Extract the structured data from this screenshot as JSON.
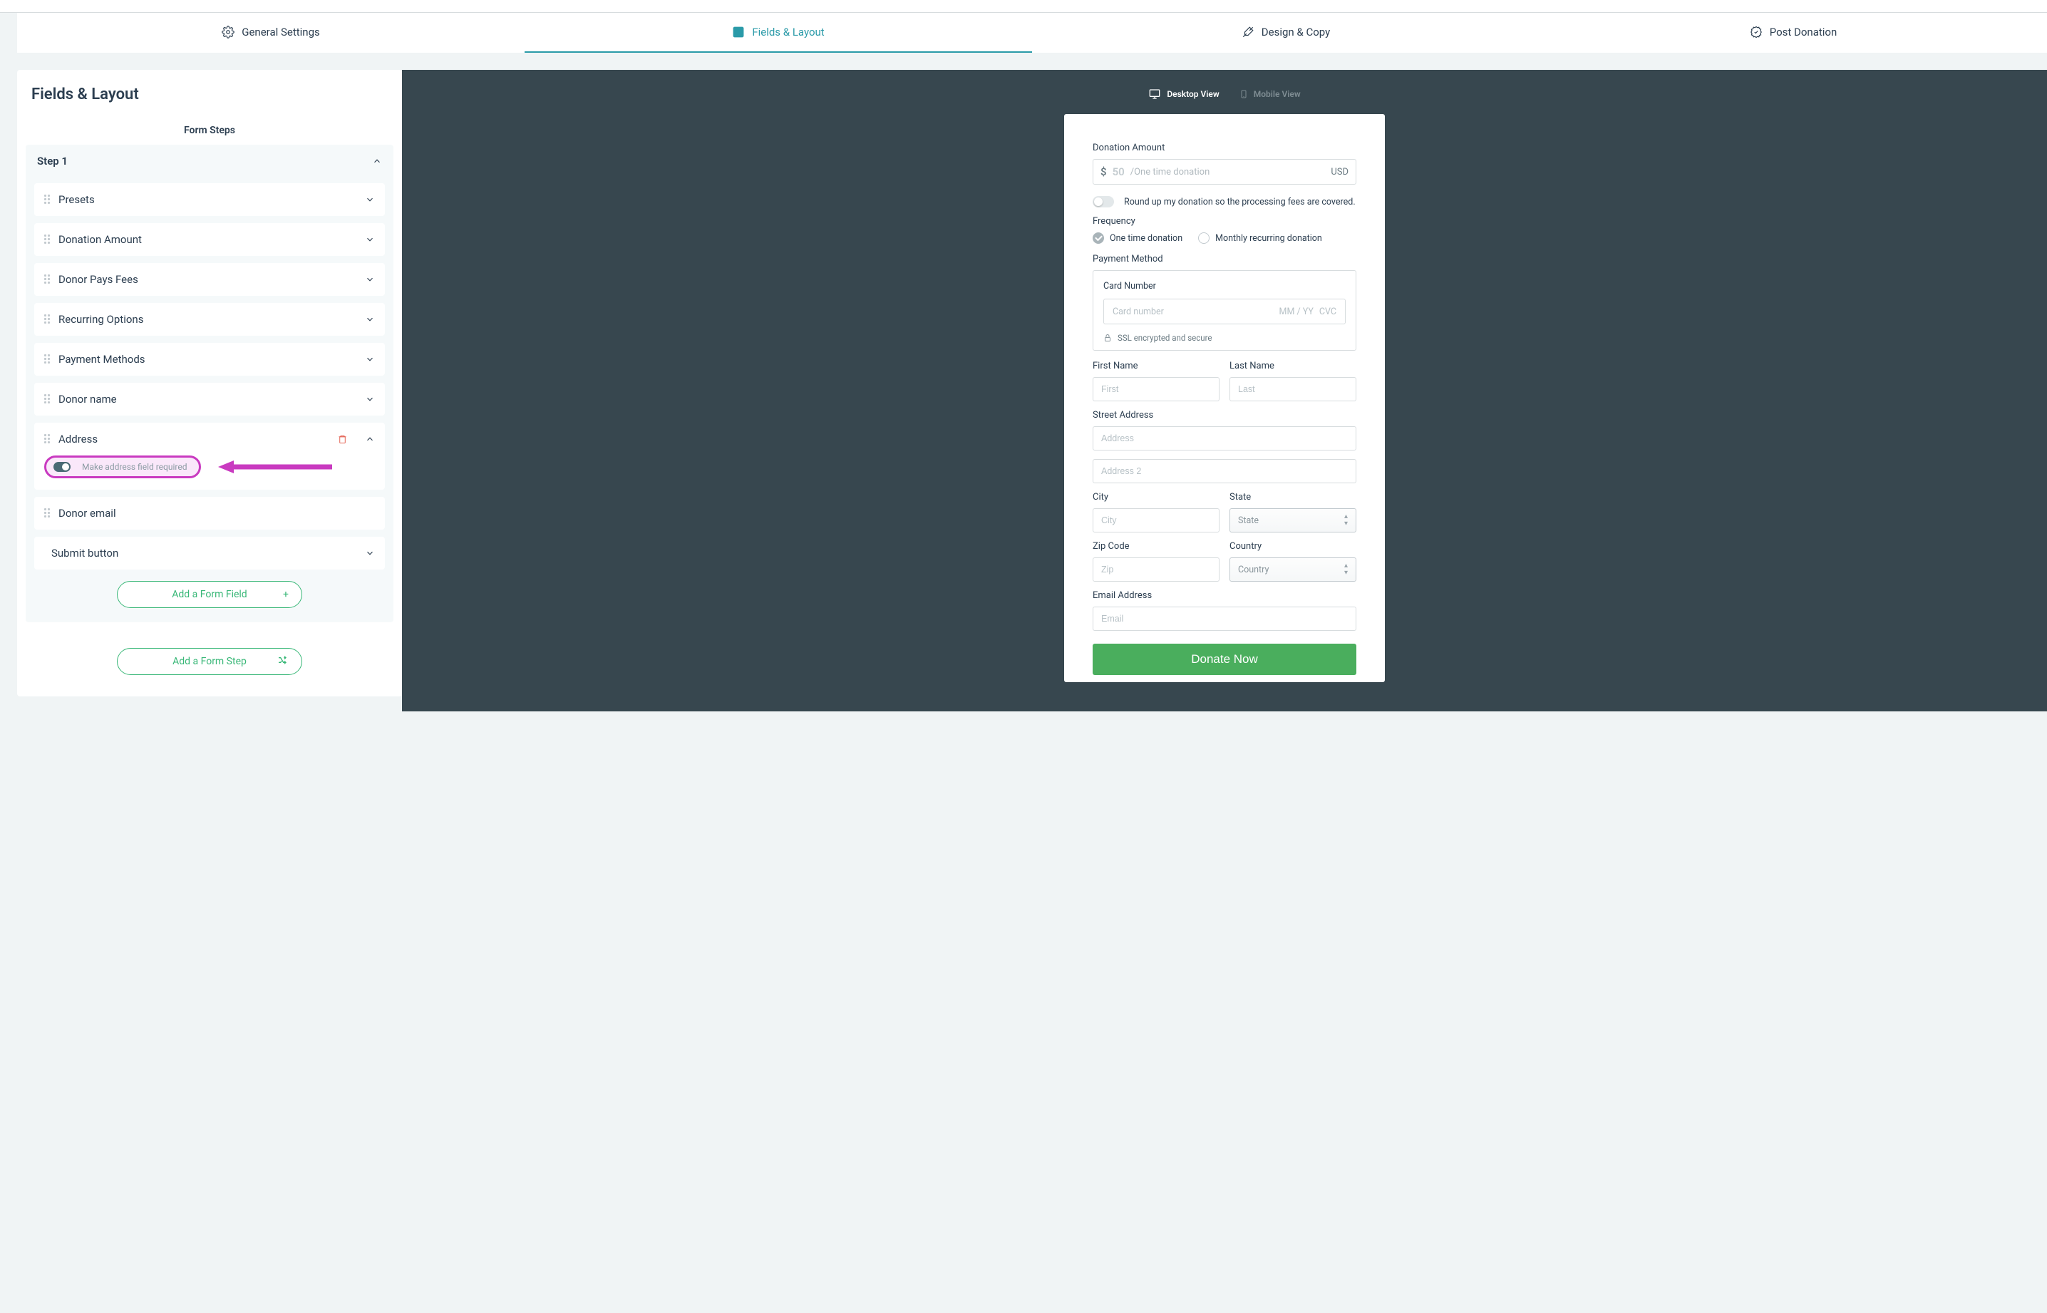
{
  "tabs": [
    {
      "label": "General Settings"
    },
    {
      "label": "Fields & Layout"
    },
    {
      "label": "Design & Copy"
    },
    {
      "label": "Post Donation"
    }
  ],
  "left": {
    "title": "Fields & Layout",
    "section": "Form Steps",
    "step_label": "Step 1",
    "fields": [
      {
        "label": "Presets"
      },
      {
        "label": "Donation Amount"
      },
      {
        "label": "Donor Pays Fees"
      },
      {
        "label": "Recurring Options"
      },
      {
        "label": "Payment Methods"
      },
      {
        "label": "Donor name"
      },
      {
        "label": "Address",
        "expanded": true,
        "sub_label": "Make address field required"
      },
      {
        "label": "Donor email"
      },
      {
        "label": "Submit button",
        "no_handle": true
      }
    ],
    "add_field": "Add a Form Field",
    "add_step": "Add a Form Step"
  },
  "preview": {
    "view_desktop": "Desktop View",
    "view_mobile": "Mobile View",
    "donation_amount_label": "Donation Amount",
    "currency_symbol": "$",
    "amount_placeholder": "50",
    "freq_hint": "/One time donation",
    "currency_code": "USD",
    "roundup_label": "Round up my donation so the processing fees are covered.",
    "frequency_label": "Frequency",
    "freq_one": "One time donation",
    "freq_monthly": "Monthly recurring donation",
    "payment_method_label": "Payment Method",
    "card_number_label": "Card Number",
    "card_number_ph": "Card number",
    "mmyy": "MM / YY",
    "cvc": "CVC",
    "ssl_text": "SSL encrypted and secure",
    "first_name_label": "First Name",
    "first_name_ph": "First",
    "last_name_label": "Last Name",
    "last_name_ph": "Last",
    "street_label": "Street Address",
    "address_ph": "Address",
    "address2_ph": "Address 2",
    "city_label": "City",
    "city_ph": "City",
    "state_label": "State",
    "state_ph": "State",
    "zip_label": "Zip Code",
    "zip_ph": "Zip",
    "country_label": "Country",
    "country_ph": "Country",
    "email_label": "Email Address",
    "email_ph": "Email",
    "donate_button": "Donate Now"
  }
}
